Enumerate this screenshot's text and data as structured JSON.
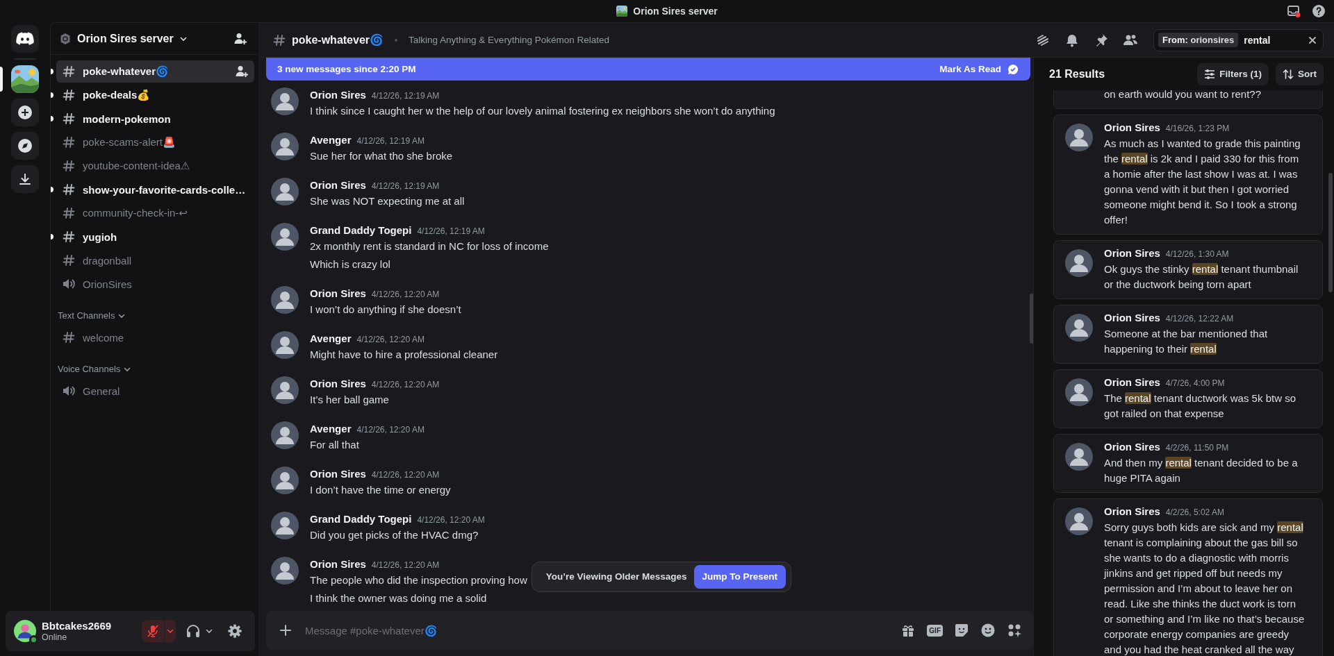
{
  "title_bar": {
    "title": "Orion Sires server"
  },
  "server_rail": {
    "servers": [
      {
        "kind": "picture",
        "selected": true
      }
    ]
  },
  "sidebar": {
    "server_name": "Orion Sires server",
    "channels": [
      {
        "name": "poke-whatever🌀",
        "kind": "text",
        "unread": true,
        "selected": true
      },
      {
        "name": "poke-deals💰",
        "kind": "text",
        "unread": true,
        "selected": false
      },
      {
        "name": "modern-pokemon",
        "kind": "text",
        "unread": true,
        "selected": false
      },
      {
        "name": "poke-scams-alert🚨",
        "kind": "text",
        "unread": false,
        "selected": false
      },
      {
        "name": "youtube-content-idea⚠",
        "kind": "text",
        "unread": false,
        "selected": false
      },
      {
        "name": "show-your-favorite-cards-colle…",
        "kind": "text",
        "unread": true,
        "selected": false
      },
      {
        "name": "community-check-in-↩",
        "kind": "text",
        "unread": false,
        "selected": false
      },
      {
        "name": "yugioh",
        "kind": "text",
        "unread": true,
        "selected": false
      },
      {
        "name": "dragonball",
        "kind": "text",
        "unread": false,
        "selected": false
      },
      {
        "name": "OrionSires",
        "kind": "voice",
        "unread": false,
        "selected": false
      }
    ],
    "categories": [
      {
        "name": "Text Channels",
        "expanded": true,
        "channels": [
          {
            "name": "welcome",
            "kind": "text",
            "unread": false,
            "selected": false
          }
        ]
      },
      {
        "name": "Voice Channels",
        "expanded": true,
        "channels": [
          {
            "name": "General",
            "kind": "voice",
            "unread": false,
            "selected": false
          }
        ]
      }
    ]
  },
  "user": {
    "name": "Bbtcakes2669",
    "status": "Online",
    "muted": true
  },
  "header": {
    "channel": "poke-whatever🌀",
    "topic": "Talking Anything & Everything Pokémon Related"
  },
  "search": {
    "filter_label": "From:",
    "filter_value": "orionsires",
    "query": "rental",
    "results_count": "21 Results",
    "filters_button": "Filters (1)",
    "sort_button": "Sort",
    "results": [
      {
        "lines": [
          "on earth would you want to rent??"
        ]
      },
      {
        "author": "Orion Sires",
        "time": "4/16/26, 1:23 PM",
        "lines": [
          "As much as I wanted to grade this painting",
          [
            {
              "text": "the ",
              "highlight": false
            },
            {
              "text": "rental",
              "highlight": true
            },
            {
              "text": " is 2k and I paid 330 for this from",
              "highlight": false
            }
          ],
          "a homie after the last show I was at. I was",
          "gonna vend with it but then I got worried",
          "someone might bend it. So I took a strong",
          "offer!"
        ]
      },
      {
        "author": "Orion Sires",
        "time": "4/12/26, 1:30 AM",
        "lines": [
          [
            {
              "text": "Ok guys the stinky ",
              "highlight": false
            },
            {
              "text": "rental",
              "highlight": true
            },
            {
              "text": " tenant thumbnail",
              "highlight": false
            }
          ],
          "or the ductwork being torn apart"
        ]
      },
      {
        "author": "Orion Sires",
        "time": "4/12/26, 12:22 AM",
        "lines": [
          "Someone at the bar mentioned that",
          [
            {
              "text": "happening to their ",
              "highlight": false
            },
            {
              "text": "rental",
              "highlight": true
            }
          ]
        ]
      },
      {
        "author": "Orion Sires",
        "time": "4/7/26, 4:00 PM",
        "lines": [
          [
            {
              "text": "The ",
              "highlight": false
            },
            {
              "text": "rental",
              "highlight": true
            },
            {
              "text": " tenant ductwork was 5k btw so",
              "highlight": false
            }
          ],
          "got railed on that expense"
        ]
      },
      {
        "author": "Orion Sires",
        "time": "4/2/26, 11:50 PM",
        "lines": [
          [
            {
              "text": "And then my ",
              "highlight": false
            },
            {
              "text": "rental",
              "highlight": true
            },
            {
              "text": " tenant decided to be a",
              "highlight": false
            }
          ],
          "huge PITA again"
        ]
      },
      {
        "author": "Orion Sires",
        "time": "4/2/26, 5:02 AM",
        "lines": [
          [
            {
              "text": "Sorry guys both kids are sick and my ",
              "highlight": false
            },
            {
              "text": "rental",
              "highlight": true
            }
          ],
          "tenant is complaining about the gas bill so",
          "she wants to do a diagnostic with morris",
          "jinkins and get ripped off but needs my",
          "permission and I’m about to leave her on",
          "read. Like she thinks the duct work is torn",
          "or something and I’m like no that’s because",
          "corporate energy companies are greedy",
          "and you had the heat cranked all the way"
        ]
      }
    ]
  },
  "chat": {
    "new_messages_bar": {
      "text": "3 new messages since 2:20 PM",
      "action": "Mark As Read"
    },
    "messages": [
      {
        "author": "Orion Sires",
        "time": "4/12/26, 12:19 AM",
        "lines": [
          "I think since I caught her w the help of our lovely animal fostering ex neighbors she won’t do anything"
        ]
      },
      {
        "author": "Avenger",
        "time": "4/12/26, 12:19 AM",
        "lines": [
          "Sue her for what tho she broke"
        ]
      },
      {
        "author": "Orion Sires",
        "time": "4/12/26, 12:19 AM",
        "lines": [
          "She was NOT expecting me at all"
        ]
      },
      {
        "author": "Grand Daddy Togepi",
        "time": "4/12/26, 12:19 AM",
        "lines": [
          "2x monthly rent is standard in NC for loss of income",
          "Which is crazy lol"
        ]
      },
      {
        "author": "Orion Sires",
        "time": "4/12/26, 12:20 AM",
        "lines": [
          "I won’t do anything if she doesn’t"
        ]
      },
      {
        "author": "Avenger",
        "time": "4/12/26, 12:20 AM",
        "lines": [
          "Might have to hire a professional cleaner"
        ]
      },
      {
        "author": "Orion Sires",
        "time": "4/12/26, 12:20 AM",
        "lines": [
          "It’s her ball game"
        ]
      },
      {
        "author": "Avenger",
        "time": "4/12/26, 12:20 AM",
        "lines": [
          "For all that"
        ]
      },
      {
        "author": "Orion Sires",
        "time": "4/12/26, 12:20 AM",
        "lines": [
          "I don’t have the time or energy"
        ]
      },
      {
        "author": "Grand Daddy Togepi",
        "time": "4/12/26, 12:20 AM",
        "lines": [
          "Did you get picks of the HVAC dmg?"
        ]
      },
      {
        "author": "Orion Sires",
        "time": "4/12/26, 12:20 AM",
        "lines": [
          "The people who did the inspection proving how",
          "I think the owner was doing me a solid"
        ]
      }
    ],
    "older_toast": {
      "text": "You’re Viewing Older Messages",
      "action": "Jump To Present"
    },
    "composer": {
      "placeholder": "Message #poke-whatever🌀",
      "gif_label": "GIF"
    }
  }
}
